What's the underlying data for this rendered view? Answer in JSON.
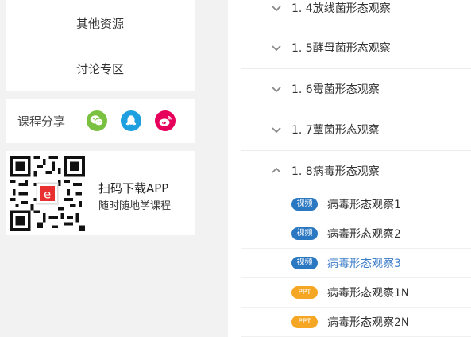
{
  "sidebar": {
    "menu": [
      {
        "label": "其他资源"
      },
      {
        "label": "讨论专区"
      }
    ],
    "share": {
      "label": "课程分享",
      "icons": [
        {
          "name": "wechat-icon",
          "color": "#7ac142"
        },
        {
          "name": "qq-icon",
          "color": "#1e9fdf"
        },
        {
          "name": "weibo-icon",
          "color": "#e6005c"
        }
      ]
    },
    "app": {
      "title": "扫码下载APP",
      "subtitle": "随时随地学课程"
    }
  },
  "outline": {
    "chapters": [
      {
        "title": "1. 4放线菌形态观察",
        "expanded": false
      },
      {
        "title": "1. 5酵母菌形态观察",
        "expanded": false
      },
      {
        "title": "1. 6霉菌形态观察",
        "expanded": false
      },
      {
        "title": "1. 7蕈菌形态观察",
        "expanded": false
      },
      {
        "title": "1. 8病毒形态观察",
        "expanded": true
      }
    ],
    "lessons": [
      {
        "badge": "视频",
        "type": "video",
        "title": "病毒形态观察1",
        "active": false
      },
      {
        "badge": "视频",
        "type": "video",
        "title": "病毒形态观察2",
        "active": false
      },
      {
        "badge": "视频",
        "type": "video",
        "title": "病毒形态观察3",
        "active": true
      },
      {
        "badge": "PPT",
        "type": "ppt",
        "title": "病毒形态观察1N",
        "active": false
      },
      {
        "badge": "PPT",
        "type": "ppt",
        "title": "病毒形态观察2N",
        "active": false
      }
    ]
  },
  "colors": {
    "accent": "#3e7ec9",
    "video_badge": "#2b78c2",
    "ppt_badge": "#f5a623"
  }
}
